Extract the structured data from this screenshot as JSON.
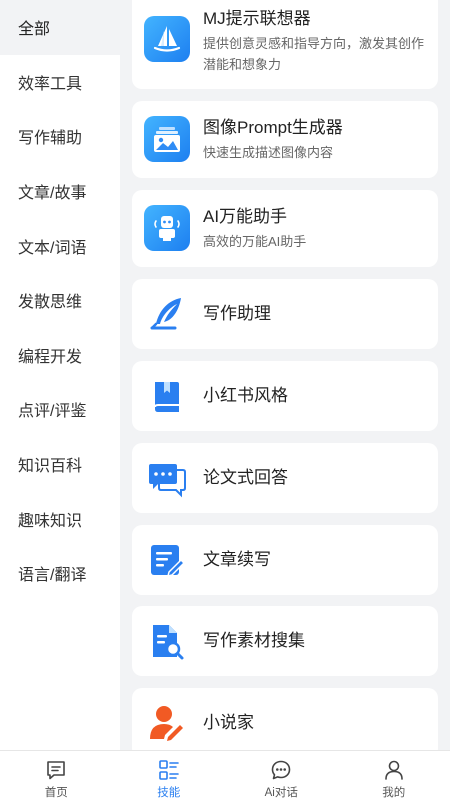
{
  "sidebar": {
    "items": [
      {
        "label": "全部"
      },
      {
        "label": "效率工具"
      },
      {
        "label": "写作辅助"
      },
      {
        "label": "文章/故事"
      },
      {
        "label": "文本/词语"
      },
      {
        "label": "发散思维"
      },
      {
        "label": "编程开发"
      },
      {
        "label": "点评/评鉴"
      },
      {
        "label": "知识百科"
      },
      {
        "label": "趣味知识"
      },
      {
        "label": "语言/翻译"
      }
    ]
  },
  "cards": [
    {
      "title": "MJ提示联想器",
      "desc": "提供创意灵感和指导方向，激发其创作潜能和想象力",
      "icon": "sailboat-icon"
    },
    {
      "title": "图像Prompt生成器",
      "desc": "快速生成描述图像内容",
      "icon": "image-gallery-icon"
    },
    {
      "title": "AI万能助手",
      "desc": "高效的万能AI助手",
      "icon": "robot-icon"
    },
    {
      "title": "写作助理",
      "icon": "feather-pen-icon"
    },
    {
      "title": "小红书风格",
      "icon": "book-icon"
    },
    {
      "title": "论文式回答",
      "icon": "chat-bubbles-icon"
    },
    {
      "title": "文章续写",
      "icon": "edit-document-icon"
    },
    {
      "title": "写作素材搜集",
      "icon": "document-search-icon"
    },
    {
      "title": "小说家",
      "icon": "writer-person-icon"
    }
  ],
  "tabbar": {
    "tabs": [
      {
        "label": "首页",
        "icon": "message-square-icon"
      },
      {
        "label": "技能",
        "icon": "skills-list-icon"
      },
      {
        "label": "Ai对话",
        "icon": "chat-dots-icon"
      },
      {
        "label": "我的",
        "icon": "person-icon"
      }
    ],
    "active_index": 1
  },
  "colors": {
    "accent": "#2a7ff0",
    "background": "#f2f3f5",
    "writer_icon": "#f15a24"
  }
}
